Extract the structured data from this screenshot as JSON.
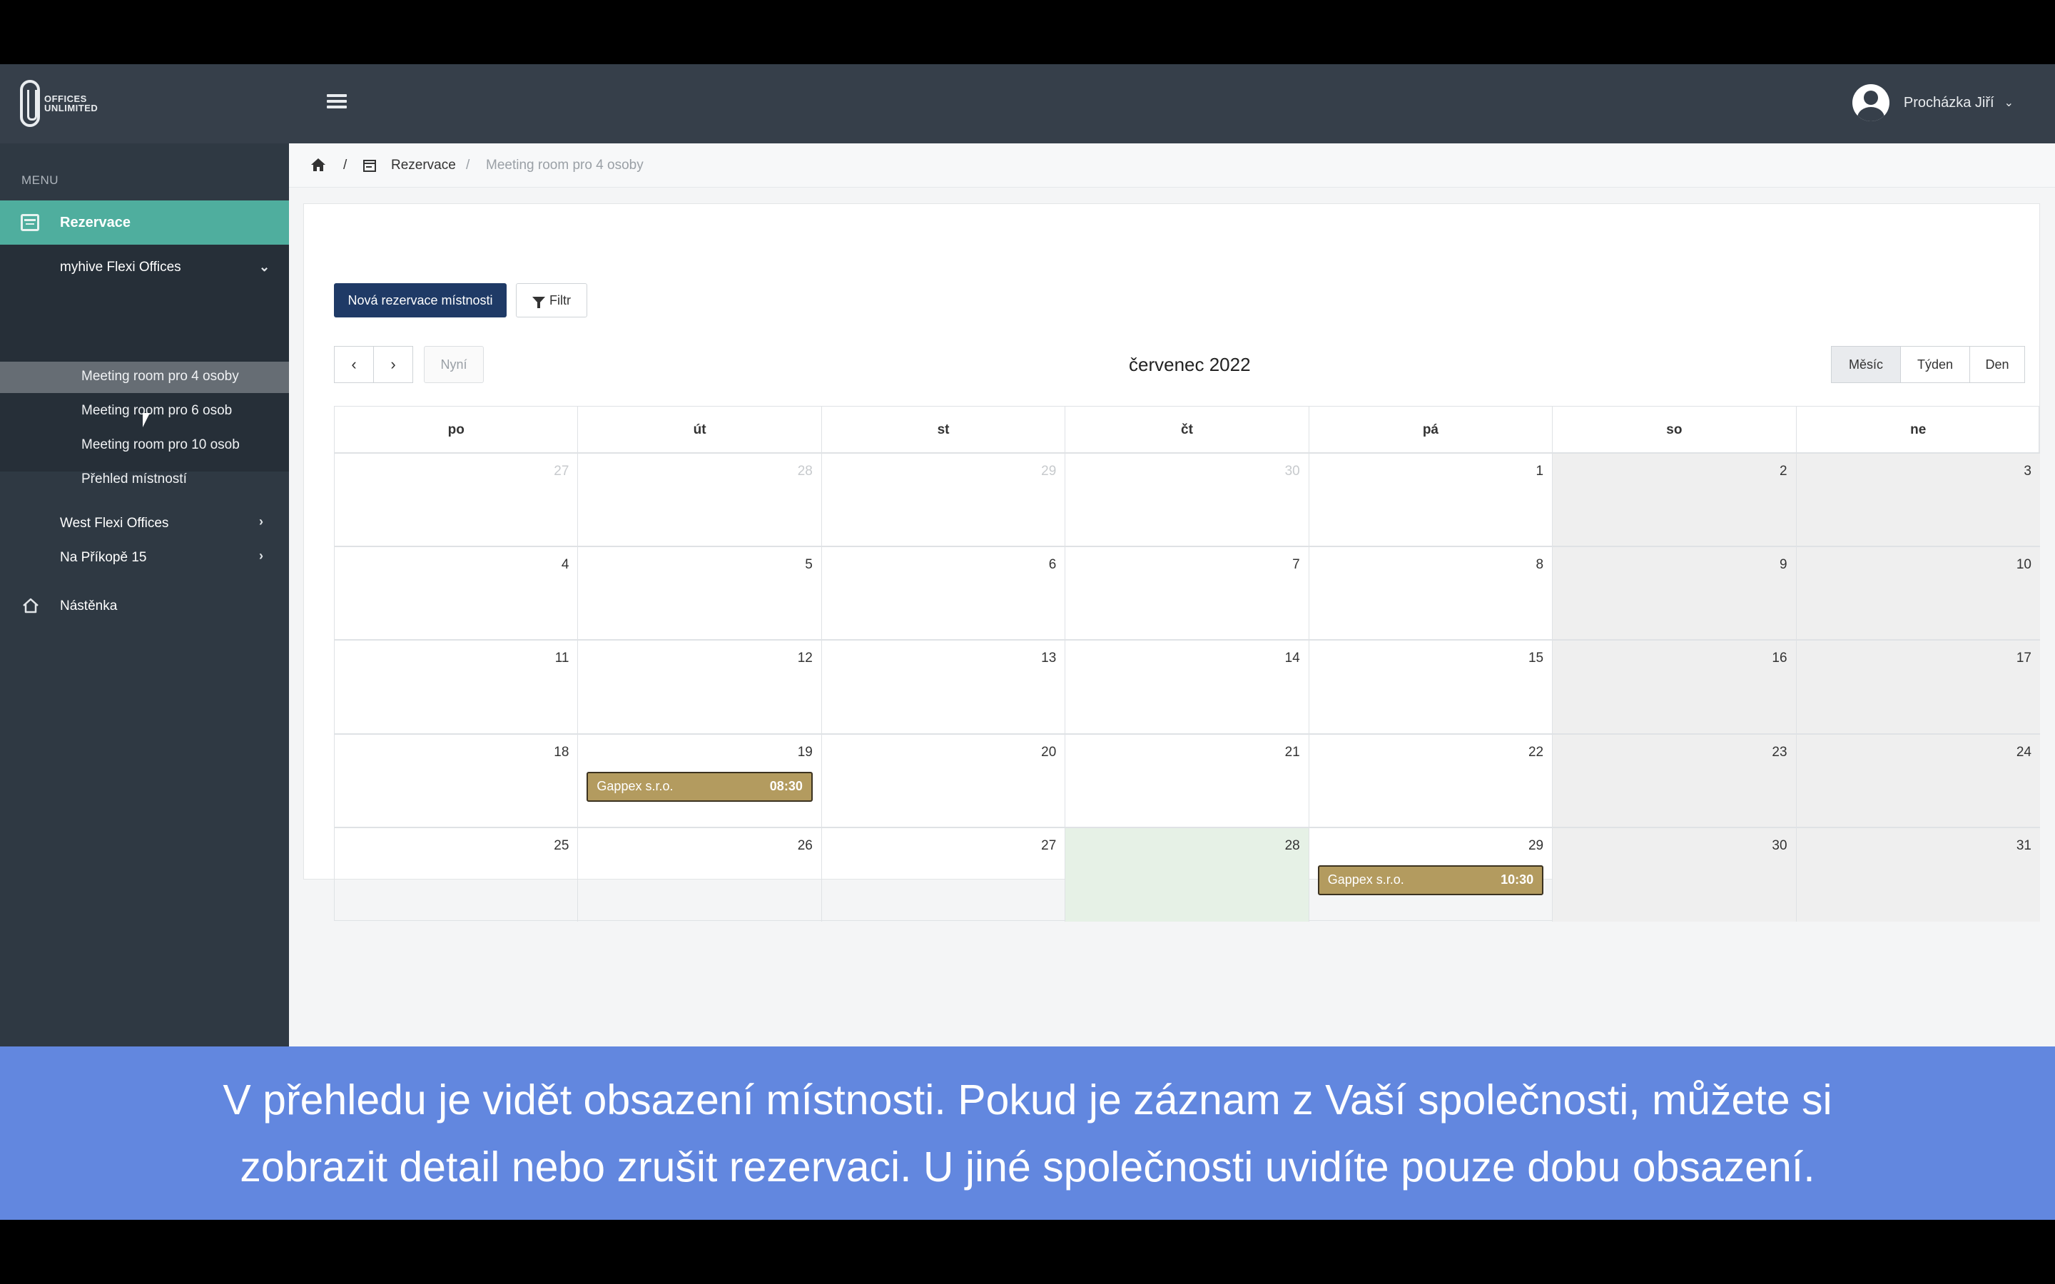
{
  "logo": {
    "text": "OFFICES\nUNLIMITED"
  },
  "header": {
    "user_name": "Procházka Jiří",
    "user_caret": "⌄"
  },
  "sidebar": {
    "menu_label": "MENU",
    "active_item": "Rezervace",
    "groups": [
      {
        "label": "myhive Flexi Offices",
        "expanded": true,
        "chevron": "⌄"
      },
      {
        "label": "West Flexi Offices",
        "expanded": false,
        "chevron": "›"
      },
      {
        "label": "Na Příkopě 15",
        "expanded": false,
        "chevron": "›"
      }
    ],
    "rooms": [
      "Meeting room pro 4 osoby",
      "Meeting room pro 6 osob",
      "Meeting room pro 10 osob",
      "Přehled místností"
    ],
    "dashboard": "Nástěnka"
  },
  "breadcrumb": {
    "sep1": "/",
    "section": "Rezervace",
    "sep2": "/",
    "current": "Meeting room pro 4 osoby"
  },
  "toolbar": {
    "new_reservation": "Nová rezervace místnosti",
    "filter": "Filtr"
  },
  "calendar": {
    "prev": "‹",
    "next": "›",
    "today": "Nyní",
    "title": "červenec 2022",
    "views": [
      "Měsíc",
      "Týden",
      "Den"
    ],
    "active_view": "Měsíc",
    "weekdays": [
      "po",
      "út",
      "st",
      "čt",
      "pá",
      "so",
      "ne"
    ],
    "weeks": [
      [
        "27",
        "28",
        "29",
        "30",
        "1",
        "2",
        "3"
      ],
      [
        "4",
        "5",
        "6",
        "7",
        "8",
        "9",
        "10"
      ],
      [
        "11",
        "12",
        "13",
        "14",
        "15",
        "16",
        "17"
      ],
      [
        "18",
        "19",
        "20",
        "21",
        "22",
        "23",
        "24"
      ],
      [
        "25",
        "26",
        "27",
        "28",
        "29",
        "30",
        "31"
      ]
    ],
    "today_date": "28",
    "events": [
      {
        "week": 3,
        "day": 1,
        "title": "Gappex s.r.o.",
        "time": "08:30"
      },
      {
        "week": 4,
        "day": 4,
        "title": "Gappex s.r.o.",
        "time": "10:30"
      }
    ]
  },
  "caption": {
    "line1": "V přehledu je vidět obsazení místnosti. Pokud je záznam z Vaší společnosti, můžete si",
    "line2": "zobrazit detail nebo zrušit rezervaci. U jiné společnosti uvidíte pouze dobu obsazení."
  },
  "colors": {
    "topbar": "#363f4a",
    "sidebar": "#2f3943",
    "active_menu": "#4fae9e",
    "primary_button": "#1f3a66",
    "event": "#b39b5f",
    "today_cell": "#e6f1e6",
    "caption": "#6287df"
  }
}
